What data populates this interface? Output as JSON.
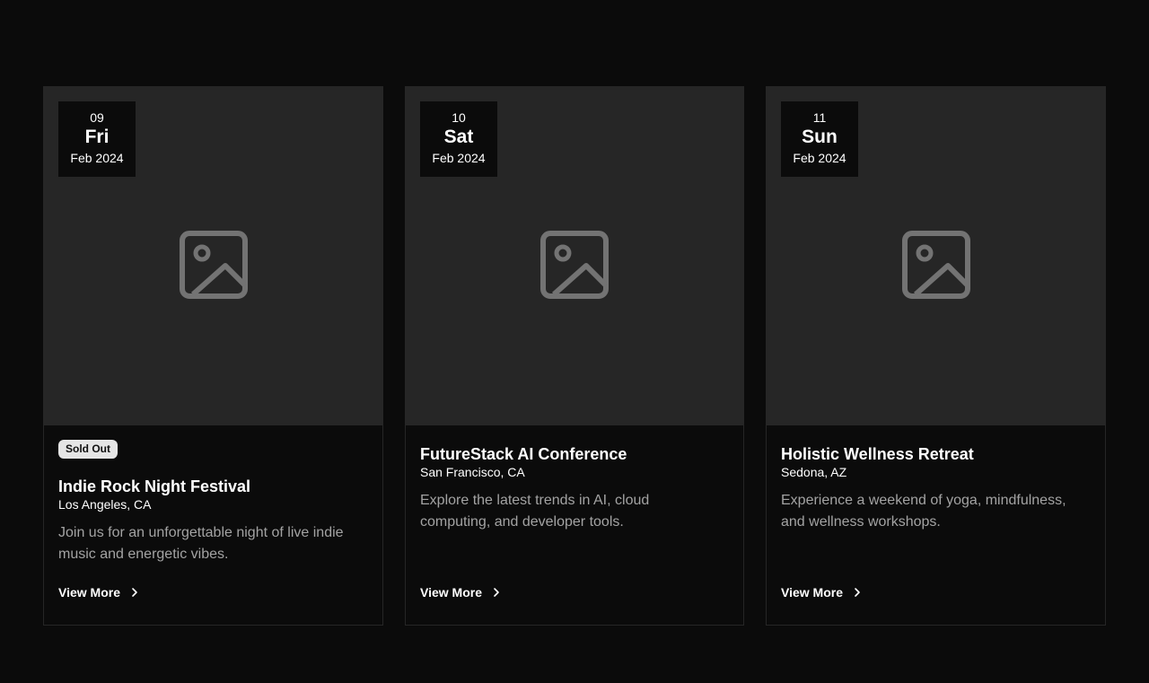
{
  "events": [
    {
      "date": {
        "day_num": "09",
        "weekday": "Fri",
        "month_year": "Feb 2024"
      },
      "badge": "Sold Out",
      "title": "Indie Rock Night Festival",
      "location": "Los Angeles, CA",
      "description": "Join us for an unforgettable night of live indie music and energetic vibes.",
      "cta": "View More"
    },
    {
      "date": {
        "day_num": "10",
        "weekday": "Sat",
        "month_year": "Feb 2024"
      },
      "title": "FutureStack AI Conference",
      "location": "San Francisco, CA",
      "description": "Explore the latest trends in AI, cloud computing, and developer tools.",
      "cta": "View More"
    },
    {
      "date": {
        "day_num": "11",
        "weekday": "Sun",
        "month_year": "Feb 2024"
      },
      "title": "Holistic Wellness Retreat",
      "location": "Sedona, AZ",
      "description": "Experience a weekend of yoga, mindfulness, and wellness workshops.",
      "cta": "View More"
    }
  ],
  "icons": {
    "placeholder": "image-placeholder-icon",
    "chevron": "chevron-right-icon"
  },
  "colors": {
    "background": "#0b0b0b",
    "media": "#262626",
    "muted_text": "#a3a3a3",
    "badge_bg": "#e5e5e5"
  }
}
